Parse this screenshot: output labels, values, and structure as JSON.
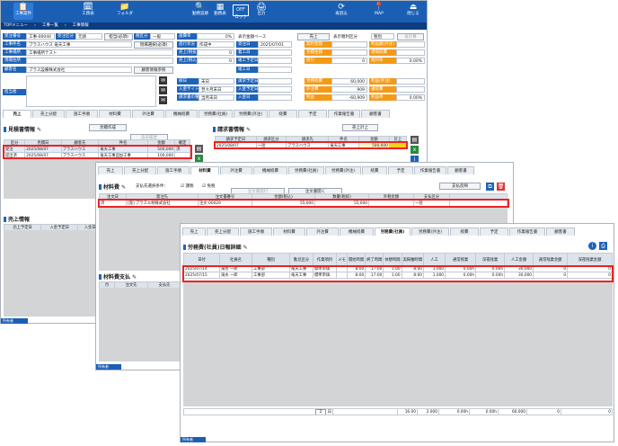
{
  "header": {
    "buttons": [
      {
        "label": "工事案件",
        "icon": "📋"
      },
      {
        "label": "工務表",
        "icon": "🗓"
      },
      {
        "label": "フォルダ",
        "icon": "📁"
      },
      {
        "label": "勤務追跡",
        "icon": "🔍"
      },
      {
        "label": "勤務表",
        "icon": "▦"
      },
      {
        "label": "ロック",
        "icon": "OFF"
      },
      {
        "label": "出力",
        "icon": "🖨"
      },
      {
        "label": "再読込",
        "icon": "⟳"
      },
      {
        "label": "MAP",
        "icon": "📍"
      },
      {
        "label": "閉じる",
        "icon": "⏏"
      }
    ]
  },
  "breadcrumb": [
    "TOPメニュー",
    "工事一覧",
    "工事情報"
  ],
  "form": {
    "row1": {
      "l1": "受注番号",
      "v1": "工事-00040",
      "l2": "受注区分",
      "v2": "元請",
      "l3": "担当(必須)",
      "v3": "",
      "l4": "税区分",
      "v4": "一般",
      "l5": "諸費率",
      "v5": "0%",
      "l6": "表示金額ベース",
      "v6": "売上",
      "l7": "表示粗利区分",
      "v7": "税別",
      "btn": "再計算"
    },
    "row2": {
      "l1": "工事件名",
      "v1": "プラスハウス 竜天工事",
      "btn": "現場選択(必須)",
      "l2": "進行状況",
      "v2": "作成中",
      "l3": "受注日",
      "v3": "2025/07/01",
      "l4": "契約金額",
      "l5": "利益額(外注)"
    },
    "row3": {
      "l1": "工事場所",
      "v1": "工事場所テスト",
      "l2": "売上(税抜)",
      "v2": "0",
      "l3": "着工日",
      "l4": "見積金額",
      "l5": "現場経費"
    },
    "row4": {
      "l1": "現場住所",
      "l2": "売上(税込)",
      "v2": "0",
      "l3": "竣工予定日",
      "l4": "値引",
      "v4": "0",
      "l5": "粗利率",
      "v5": "0.00%"
    },
    "row5": {
      "l1": "顧客名",
      "v1": "プラス設備株式会社",
      "btn": "顧客情報参照",
      "l3": "竣工日"
    },
    "row6": {
      "l1": "担当者",
      "l2": "締日",
      "v2": "末日",
      "l3": "請求予定日",
      "l4": "労務経費",
      "v4": "60,000",
      "l5": "利益(外注)"
    },
    "row7": {
      "l2": "入金サイト",
      "v2": "翌々月末日",
      "l3": "入金予定日",
      "l4": "外注費",
      "v4": "909",
      "l5": "諸経費"
    },
    "row8": {
      "l2": "請求書の種類",
      "v2": "当月末日",
      "l3": "入金日",
      "l4": "利益",
      "v4": "-60,909",
      "l5": "利益率",
      "v5": "0.00%"
    }
  },
  "tabs1": [
    "売上",
    "売上分配",
    "施工手順",
    "材料費",
    "外注費",
    "機械経費",
    "労務費(社員)",
    "労務費(外注)",
    "経費",
    "予定",
    "作業報告書",
    "顧客書"
  ],
  "tabs2": [
    "売上",
    "売上分配",
    "施工手順",
    "材料費",
    "外注費",
    "機械経費",
    "労務費(社員)",
    "労務費(外注)",
    "経費",
    "予定",
    "作業報告書",
    "顧客書"
  ],
  "tabs3": [
    "売上",
    "売上分配",
    "施工手順",
    "材料費",
    "外注費",
    "機械経費",
    "労務費(社員)",
    "労務費(外注)",
    "経費",
    "予定",
    "作業報告書",
    "顧客書"
  ],
  "estimate": {
    "title": "見積書情報",
    "btn_add": "見積作成",
    "btn_copy": "過去履歴",
    "headers": [
      "区分",
      "見積日",
      "顧客先",
      "件名",
      "金額",
      "確定"
    ],
    "rows": [
      [
        "受注",
        "2025/08/07",
        "プラスハウス",
        "竜天工事",
        "500,000",
        "済"
      ],
      [
        "提出済",
        "2025/08/07",
        "プラスハウス",
        "竜天工事追加工事",
        "100,000",
        ""
      ]
    ]
  },
  "invoice": {
    "title": "請求書情報",
    "btn": "売上計上",
    "headers": [
      "請求予定日",
      "請求区分",
      "請求先",
      "件名",
      "金額",
      "計上"
    ],
    "rows": [
      [
        "2025/08/07",
        "一括",
        "プラスハウス",
        "竜天工事",
        "500,000",
        ""
      ]
    ]
  },
  "sales": {
    "title": "売上情報",
    "headers": [
      "売上予定日",
      "入金予定日",
      "入金日"
    ]
  },
  "material": {
    "title": "材料費",
    "filter": "支払先選択条件：",
    "chk1": "課税",
    "chk2": "免税",
    "btn1": "注文書発行",
    "btn2": "注文書開く",
    "btn3": "支払反映",
    "headers": [
      "注文日",
      "発注先",
      "注文書番号",
      "金額(税込)",
      "数量(税抜)",
      "外税金額",
      "支払区分"
    ],
    "rows": [
      [
        "済",
        "[発] プラスエ材株式会社",
        "注文-00029",
        "55,000",
        "55,000",
        "",
        "一括"
      ]
    ]
  },
  "payment": {
    "title": "材料費支払",
    "headers": [
      "月",
      "注文先",
      "支払先"
    ]
  },
  "labor": {
    "title": "労務費(社員)日報詳細",
    "headers": [
      "日付",
      "社員名",
      "種別",
      "勤怠区分",
      "作業項目",
      "メモ",
      "開始時間",
      "終了時間",
      "休憩時間",
      "実稼働時間",
      "人工",
      "通常残業",
      "深夜残業",
      "人工金額",
      "通常残業金額",
      "深夜残業金額"
    ],
    "rows": [
      [
        "2025/07/14",
        "滝水 一郎",
        "工事部",
        "竜天工事",
        "標準単価",
        "",
        "8:00",
        "17:00",
        "1:00",
        "8:00",
        "1.000",
        "0.00h",
        "0.00h",
        "30,000",
        "0",
        "0"
      ],
      [
        "2025/07/15",
        "滝水 一郎",
        "工事部",
        "竜天工事",
        "標準単価",
        "",
        "8:00",
        "17:00",
        "1:00",
        "8:00",
        "1.000",
        "0.00h",
        "0.00h",
        "30,000",
        "0",
        "0"
      ]
    ],
    "footer": {
      "count": "2",
      "unit": "日",
      "total_hours": "16.00",
      "total_ninku": "2.000",
      "ot": "0.00h",
      "lt": "0.00h",
      "amount": "60,000",
      "ot_amt": "0",
      "lt_amt": "0"
    }
  },
  "status": "所有者"
}
